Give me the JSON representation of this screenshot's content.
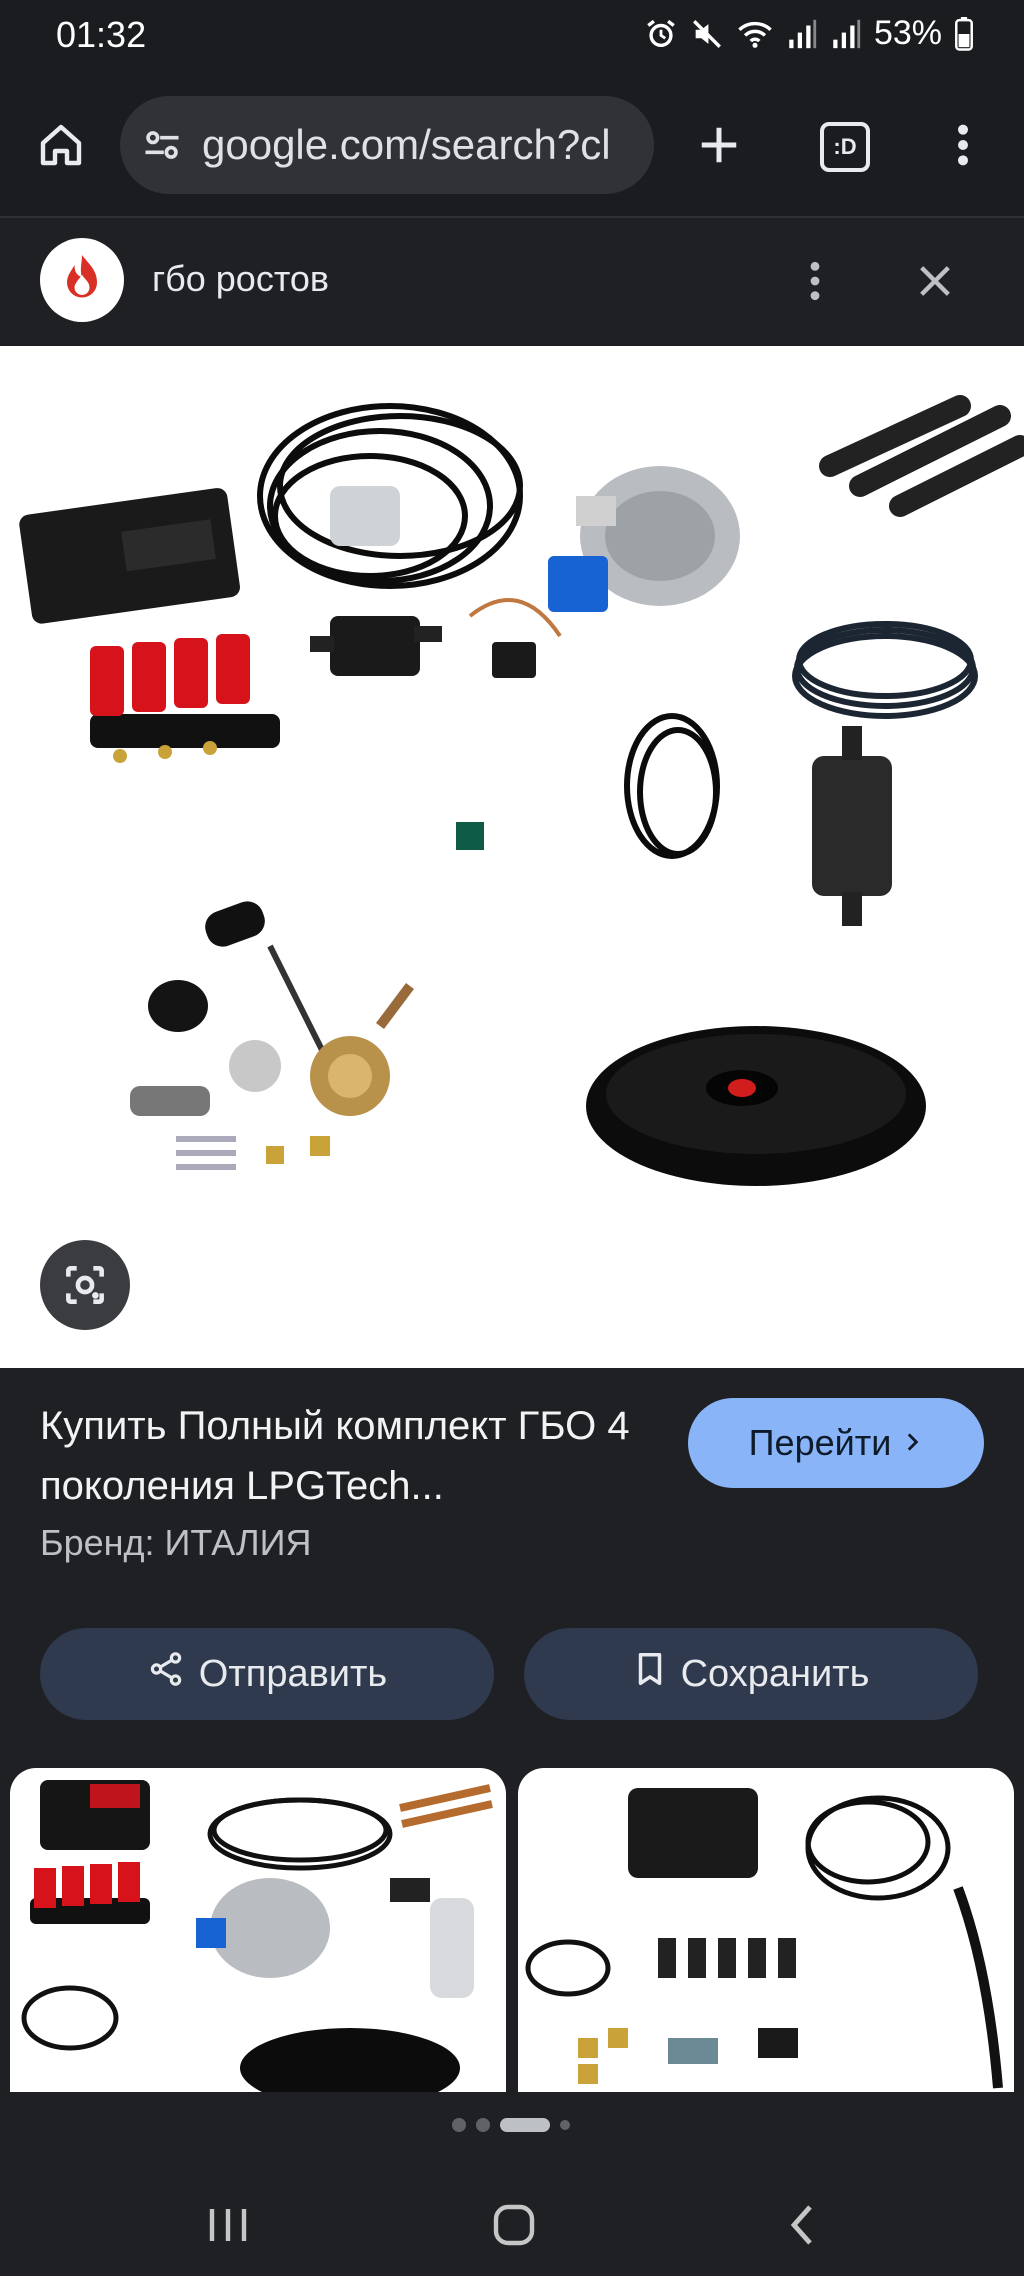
{
  "status_bar": {
    "time": "01:32",
    "battery": "53%",
    "icons": [
      "alarm-icon",
      "mute-icon",
      "wifi-icon",
      "signal-icon",
      "signal-icon",
      "battery-icon"
    ]
  },
  "browser": {
    "url": "google.com/search?cl",
    "tab_count": ":D",
    "icons": [
      "home-icon",
      "site-settings-icon",
      "new-tab-icon",
      "tabs-icon",
      "more-icon"
    ]
  },
  "lens": {
    "query": "гбо ростов"
  },
  "result": {
    "title": "Купить Полный комплект ГБО 4 поколения LPGTech...",
    "brand": "Бренд: ИТАЛИЯ",
    "go_label": "Перейти",
    "share_label": "Отправить",
    "save_label": "Сохранить"
  },
  "pager": {
    "count": 4,
    "active_index": 2
  },
  "colors": {
    "background": "#1f2024",
    "accent": "#8ab4f8",
    "pill": "#2f3a4e"
  }
}
